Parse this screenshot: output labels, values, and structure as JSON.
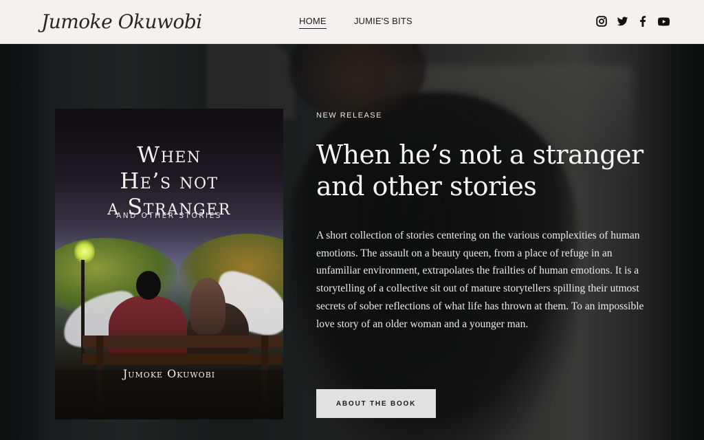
{
  "header": {
    "logo_text": "Jumoke Okuwobi",
    "nav": [
      {
        "label": "HOME",
        "active": true
      },
      {
        "label": "JUMIE'S BITS",
        "active": false
      }
    ],
    "social_icons": [
      "instagram-icon",
      "twitter-icon",
      "facebook-icon",
      "youtube-icon"
    ]
  },
  "hero": {
    "eyebrow": "NEW RELEASE",
    "title": "When he’s not a stranger and other stories",
    "description": "A short collection of stories centering on the various complexities of human emotions. The assault on a beauty queen, from a place of refuge in an unfamiliar environment, extrapolates the frailties of human emotions. It is a storytelling of a collective sit out of mature storytellers spilling their utmost secrets of sober reflections of what life has thrown at them. To an impossible love story of an older woman and a younger man.",
    "cta_label": "ABOUT THE BOOK"
  },
  "book_cover": {
    "title_line1": "When",
    "title_line2": "He’s not",
    "title_line3": "a Stranger",
    "subtitle": "AND OTHER STORIES",
    "author": "Jumoke Okuwobi"
  },
  "colors": {
    "header_bg": "#f4f1ee",
    "hero_text": "#f7f6f3",
    "button_bg": "#e1e2e0"
  }
}
